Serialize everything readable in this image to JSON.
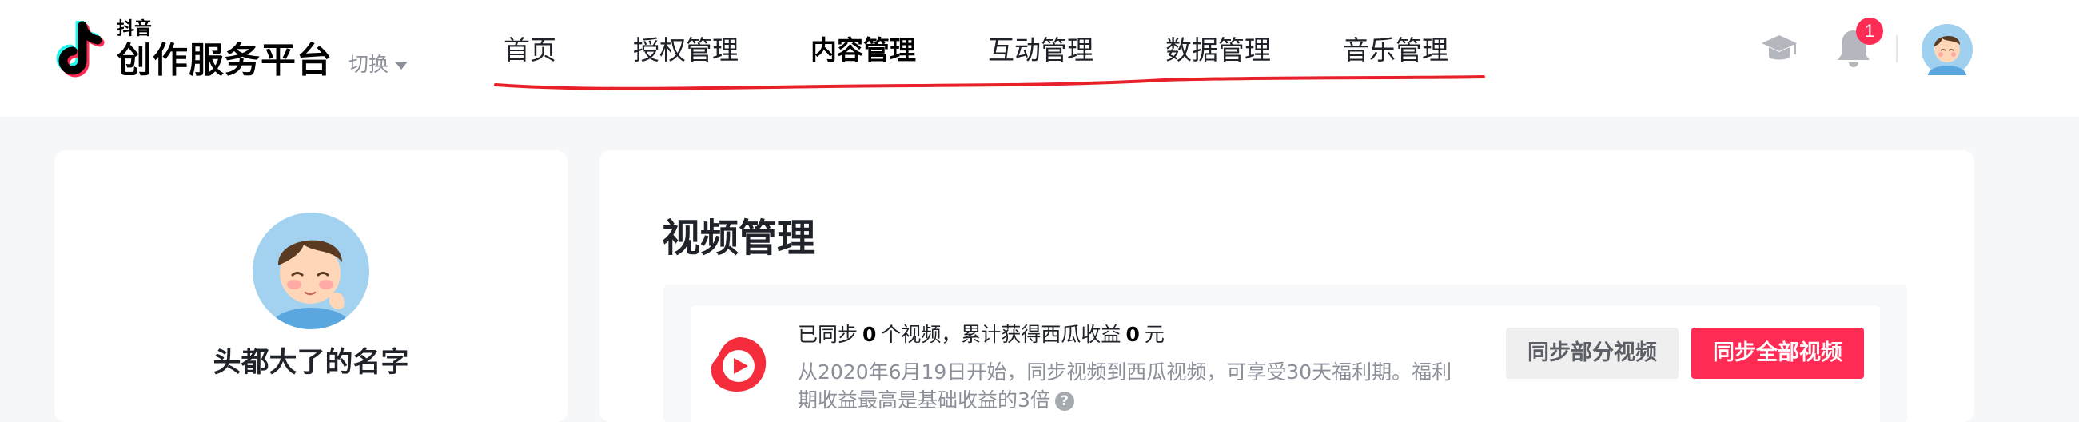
{
  "brand": {
    "small": "抖音",
    "name": "创作服务平台",
    "switch_label": "切换"
  },
  "nav": {
    "items": [
      {
        "label": "首页",
        "active": false
      },
      {
        "label": "授权管理",
        "active": false
      },
      {
        "label": "内容管理",
        "active": true
      },
      {
        "label": "互动管理",
        "active": false
      },
      {
        "label": "数据管理",
        "active": false
      },
      {
        "label": "音乐管理",
        "active": false
      }
    ]
  },
  "header_right": {
    "notification_count": "1",
    "icons": [
      "graduation-cap-icon",
      "bell-icon",
      "avatar"
    ]
  },
  "profile": {
    "name": "头都大了的名字"
  },
  "main": {
    "title": "视频管理",
    "sync": {
      "prefix": "已同步",
      "video_count": "0",
      "middle": "个视频，累计获得西瓜收益",
      "earnings": "0",
      "suffix": "元",
      "description": "从2020年6月19日开始，同步视频到西瓜视频，可享受30天福利期。福利期收益最高是基础收益的3倍",
      "help_glyph": "?",
      "partial_button": "同步部分视频",
      "all_button": "同步全部视频"
    }
  },
  "colors": {
    "accent": "#fe2c55",
    "annotation_red": "#e8202a",
    "page_bg": "#f6f7f8"
  }
}
